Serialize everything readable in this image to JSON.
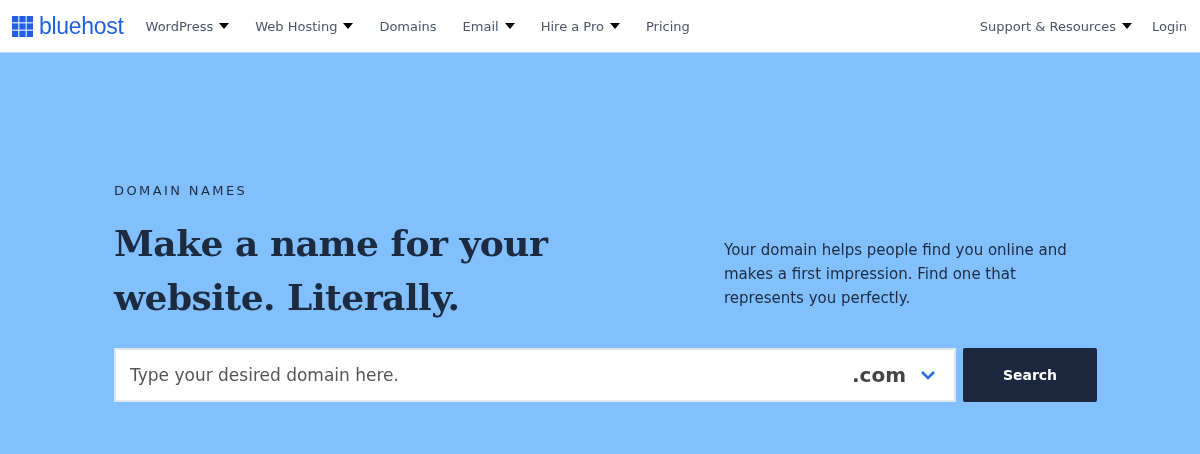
{
  "brand": {
    "name": "bluehost"
  },
  "nav": [
    {
      "label": "WordPress",
      "dropdown": true
    },
    {
      "label": "Web Hosting",
      "dropdown": true
    },
    {
      "label": "Domains",
      "dropdown": false
    },
    {
      "label": "Email",
      "dropdown": true
    },
    {
      "label": "Hire a Pro",
      "dropdown": true
    },
    {
      "label": "Pricing",
      "dropdown": false
    }
  ],
  "nav_right": [
    {
      "label": "Support & Resources",
      "dropdown": true
    },
    {
      "label": "Login",
      "dropdown": false
    }
  ],
  "hero": {
    "eyebrow": "DOMAIN NAMES",
    "headline": "Make a name for your website. Literally.",
    "description": "Your domain helps people find you online and makes a first impression. Find one that represents you perfectly."
  },
  "search": {
    "placeholder": "Type your desired domain here.",
    "tld": ".com",
    "button": "Search"
  }
}
